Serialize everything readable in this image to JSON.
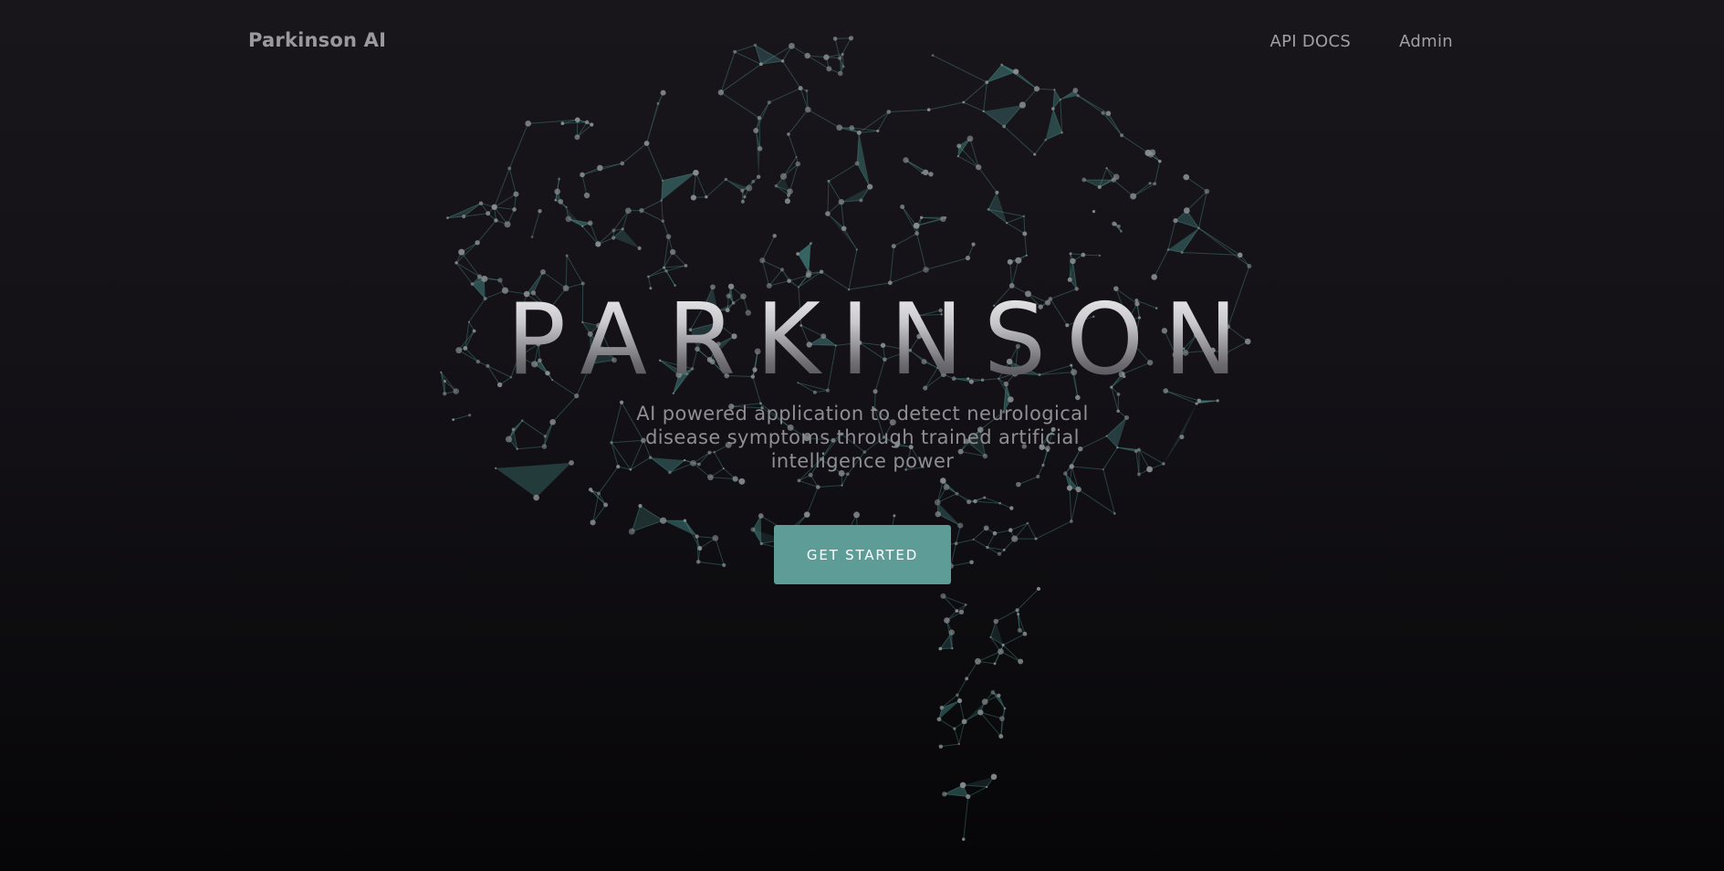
{
  "navbar": {
    "brand": "Parkinson AI",
    "links": [
      {
        "label": "API DOCS"
      },
      {
        "label": "Admin"
      }
    ]
  },
  "hero": {
    "title": "PARKINSON",
    "subtitle": "AI powered application to detect neurological disease symptoms through trained artificial intelligence power",
    "cta_label": "GET STARTED"
  },
  "colors": {
    "accent": "#5e9c97",
    "network": "#4e9994",
    "background": "#131116"
  },
  "decoration": {
    "icon": "brain-network-icon"
  }
}
